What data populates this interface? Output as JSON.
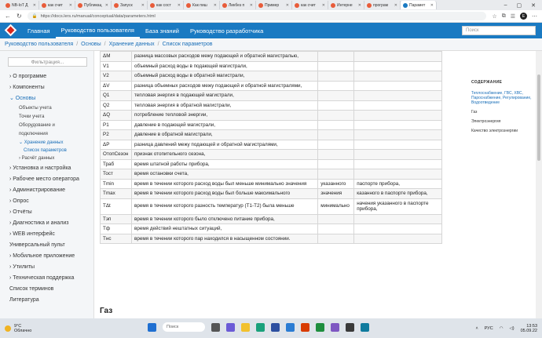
{
  "browser": {
    "tabs": [
      {
        "label": "NB-IoT Д",
        "active": false
      },
      {
        "label": "как счит",
        "active": false
      },
      {
        "label": "Публикац",
        "active": false
      },
      {
        "label": "Запуск",
        "active": false
      },
      {
        "label": "как сост",
        "active": false
      },
      {
        "label": "Как пиш",
        "active": false
      },
      {
        "label": "Ликбез п",
        "active": false
      },
      {
        "label": "Пример",
        "active": false
      },
      {
        "label": "как счит",
        "active": false
      },
      {
        "label": "Интерне",
        "active": false
      },
      {
        "label": "програм",
        "active": false
      },
      {
        "label": "Парамет",
        "active": true
      }
    ],
    "url": "https://docs.lers.ru/manual/conceptual/data/parameters.html",
    "profile_initial": "E"
  },
  "topnav": {
    "items": [
      "Главная",
      "Руководство пользователя",
      "База знаний",
      "Руководство разработчика"
    ],
    "active_index": 1,
    "search_placeholder": "Поиск"
  },
  "breadcrumbs": [
    "Руководство пользователя",
    "Основы",
    "Хранение данных",
    "Список параметров"
  ],
  "sidebar": {
    "filter_placeholder": "Фильтрация...",
    "items": [
      {
        "label": "› О программе",
        "level": 0
      },
      {
        "label": "› Компоненты",
        "level": 0
      },
      {
        "label": "⌄ Основы",
        "level": 0,
        "cls": "blue"
      },
      {
        "label": "Объекты учета",
        "level": 1
      },
      {
        "label": "Точки учета",
        "level": 1
      },
      {
        "label": "Оборудование и",
        "level": 1
      },
      {
        "label": "подключения",
        "level": 1
      },
      {
        "label": "⌄ Хранение данных",
        "level": 1,
        "cls": "cur"
      },
      {
        "label": "Список параметров",
        "level": 2
      },
      {
        "label": "› Расчёт данных",
        "level": 1
      },
      {
        "label": "› Установка и настройка",
        "level": 0
      },
      {
        "label": "› Рабочее место оператора",
        "level": 0
      },
      {
        "label": "› Администрирование",
        "level": 0
      },
      {
        "label": "› Опрос",
        "level": 0
      },
      {
        "label": "› Отчёты",
        "level": 0
      },
      {
        "label": "› Диагностика и анализ",
        "level": 0
      },
      {
        "label": "› WEB интерфейс",
        "level": 0
      },
      {
        "label": "Универсальный пульт",
        "level": 0
      },
      {
        "label": "› Мобильное приложение",
        "level": 0
      },
      {
        "label": "› Утилиты",
        "level": 0
      },
      {
        "label": "› Техническая поддержка",
        "level": 0
      },
      {
        "label": "Список терминов",
        "level": 0
      },
      {
        "label": "Литература",
        "level": 0
      }
    ]
  },
  "table": {
    "rows": [
      [
        "ΔM",
        "разница массовых расходов межу подающей и обратной магистралью,",
        "",
        ""
      ],
      [
        "V1",
        "объемный расход воды в подающей магистрали,",
        "",
        ""
      ],
      [
        "V2",
        "объемный расход воды в обратной магистрали,",
        "",
        ""
      ],
      [
        "ΔV",
        "разница объемных расходов межу подающей и обратной магистралями,",
        "",
        ""
      ],
      [
        "Q1",
        "тепловая энергия в подающей магистрали,",
        "",
        ""
      ],
      [
        "Q2",
        "тепловая энергия в обратной магистрали,",
        "",
        ""
      ],
      [
        "ΔQ",
        "потребление тепловой энергии,",
        "",
        ""
      ],
      [
        "P1",
        "давление в подающей магистрали,",
        "",
        ""
      ],
      [
        "P2",
        "давление в обратной магистрали,",
        "",
        ""
      ],
      [
        "ΔP",
        "разница давлений межу подающей и обратной магистралями,",
        "",
        ""
      ],
      [
        "ОтопСезон",
        "признак отопительного сезона,",
        "",
        ""
      ],
      [
        "Траб",
        "время штатной работы прибора,",
        "",
        ""
      ],
      [
        "Тост",
        "время остановки счета,",
        "",
        ""
      ],
      [
        "Tmin",
        "время в течении которого расход воды был меньше минимально значения",
        "указанного",
        "паспорте прибора,"
      ],
      [
        "Tmax",
        "время в течении которого расход воды был больше максимального",
        "значения",
        "казанного в паспорте прибора,"
      ],
      [
        "TΔt",
        "время в течении которого разность температур (T1-T2) была меньше",
        "минимально",
        "начения указанного в паспорте прибора,"
      ],
      [
        "Тэп",
        "время в течении которого было отключено питание прибора,",
        "",
        ""
      ],
      [
        "Тф",
        "время действий нештатных ситуаций,",
        "",
        ""
      ],
      [
        "Тнс",
        "время в течении которого пар находился в насыщенном состоянии.",
        "",
        ""
      ]
    ]
  },
  "section_heading": "Газ",
  "toc": {
    "title": "СОДЕРЖАНИЕ",
    "items": [
      {
        "label": "Теплоснабжение, ГВС, ХВС, Пароснабжение, Регулирование, Водоотведение",
        "active": true
      },
      {
        "label": "Газ",
        "active": false
      },
      {
        "label": "Электроэнергия",
        "active": false
      },
      {
        "label": "Качество электроэнергии",
        "active": false
      }
    ]
  },
  "taskbar": {
    "weather_temp": "9°C",
    "weather_desc": "Облачно",
    "search_label": "Поиск",
    "lang": "РУС",
    "time": "13:53",
    "date": "05.09.22"
  }
}
